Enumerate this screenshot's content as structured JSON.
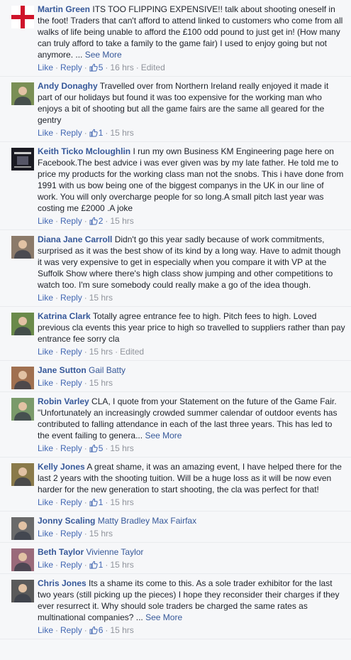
{
  "labels": {
    "like": "Like",
    "reply": "Reply",
    "see_more": "See More",
    "dot": "·"
  },
  "comments": [
    {
      "author": "Martin Green",
      "text": "ITS TOO FLIPPING EXPENSIVE!! talk about shooting oneself in the foot! Traders that can't afford to attend linked to customers who come from all walks of life being unable to afford the £100 odd pound to just get in! (How many can truly afford to take a family to the game fair) I used to enjoy going but not anymore. ...",
      "see_more": true,
      "likes": "5",
      "time": "16 hrs",
      "edited": "Edited",
      "avatar_icon": "england-flag-avatar",
      "avatar_color": "#dcdcdc"
    },
    {
      "author": "Andy Donaghy",
      "text": "Travelled over from Northern Ireland really enjoyed it made it part of our holidays but found it was too expensive for the working man who enjoys a bit of shooting but all the game fairs are the same all geared for the gentry",
      "likes": "1",
      "time": "15 hrs",
      "avatar_icon": "person-avatar",
      "avatar_color": "#7a8f55"
    },
    {
      "author": "Keith Ticko Mcloughlin",
      "text": "I run my own Business KM Engineering page here on Facebook.The best advice i was ever given was by my late father. He told me to price my products for the working class man not the snobs. This i have done from 1991 with us bow being one of the biggest companys in the UK in our line of work. You will only overcharge people for so long.A small pitch last year was costing me £2000 .A joke",
      "likes": "2",
      "time": "15 hrs",
      "avatar_icon": "dark-poster-avatar",
      "avatar_color": "#1a1a22"
    },
    {
      "author": "Diana Jane Carroll",
      "text": "Didn't go this year sadly because of work commitments, surprised as it was the best show of its kind by a long way. Have to admit though it was very expensive to get in especially when you compare it with VP at the Suffolk Show where there's high class show jumping and other competitions to watch too. I'm sure somebody could really make a go of the idea though.",
      "time": "15 hrs",
      "avatar_icon": "couple-avatar",
      "avatar_color": "#8b7a6a"
    },
    {
      "author": "Katrina Clark",
      "text": "Totally agree entrance fee to high. Pitch fees to high. Loved previous cla events this year price to high so travelled to suppliers rather than pay entrance fee sorry cla",
      "time": "15 hrs",
      "edited": "Edited",
      "avatar_icon": "landscape-avatar",
      "avatar_color": "#6a8a4a"
    },
    {
      "author": "Jane Sutton",
      "tags": [
        "Gail Batty"
      ],
      "text": "",
      "time": "15 hrs",
      "avatar_icon": "woman-avatar",
      "avatar_color": "#a07050"
    },
    {
      "author": "Robin Varley",
      "text": "CLA, I quote from your Statement on the future of the Game Fair. \"Unfortunately an increasingly crowded summer calendar of outdoor events has contributed to falling attendance in each of the last three years. This has led to the event failing to genera...",
      "see_more": true,
      "likes": "5",
      "time": "15 hrs",
      "avatar_icon": "outdoor-couple-avatar",
      "avatar_color": "#7a9a6a"
    },
    {
      "author": "Kelly Jones",
      "text": "A great shame, it was an amazing event, I have helped there for the last 2 years with the shooting tuition. Will be a huge loss as it will be now even harder for the new generation to start shooting, the cla was perfect for that!",
      "likes": "1",
      "time": "15 hrs",
      "avatar_icon": "field-avatar",
      "avatar_color": "#8a7a4a"
    },
    {
      "author": "Jonny Scaling",
      "tags": [
        "Matty Bradley",
        "Max Fairfax"
      ],
      "text": "",
      "time": "15 hrs",
      "avatar_icon": "man-avatar",
      "avatar_color": "#6a6a6a"
    },
    {
      "author": "Beth Taylor",
      "tags": [
        "Vivienne Taylor"
      ],
      "text": "",
      "likes": "1",
      "time": "15 hrs",
      "avatar_icon": "group-avatar",
      "avatar_color": "#9a6a7a"
    },
    {
      "author": "Chris Jones",
      "text": "Its a shame its come to this. As a sole trader exhibitor for the last two years (still picking up the pieces) I hope they reconsider their charges if they ever resurrect it. Why should sole traders be charged the same rates as multinational companies? ...",
      "see_more": true,
      "likes": "6",
      "time": "15 hrs",
      "avatar_icon": "man-portrait-avatar",
      "avatar_color": "#5a5a5a"
    }
  ]
}
